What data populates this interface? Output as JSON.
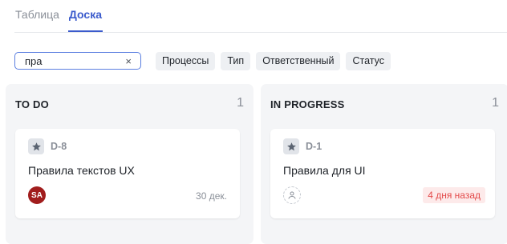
{
  "tabs": {
    "table": "Таблица",
    "board": "Доска"
  },
  "search": {
    "value": "пра",
    "clear_icon": "×"
  },
  "filters": [
    "Процессы",
    "Тип",
    "Ответственный",
    "Статус"
  ],
  "columns": [
    {
      "title": "TO DO",
      "count": "1",
      "card": {
        "id": "D-8",
        "title": "Правила текстов UX",
        "assignee_initials": "SA",
        "date": "30 дек."
      }
    },
    {
      "title": "IN PROGRESS",
      "count": "1",
      "card": {
        "id": "D-1",
        "title": "Правила для UI",
        "overdue": "4 дня назад"
      }
    }
  ],
  "colors": {
    "accent": "#3b5bcc",
    "avatar": "#a11d1d",
    "overdue": "#e34a4a"
  },
  "icons": {
    "card_type": "star-icon",
    "unassigned": "user-icon"
  }
}
